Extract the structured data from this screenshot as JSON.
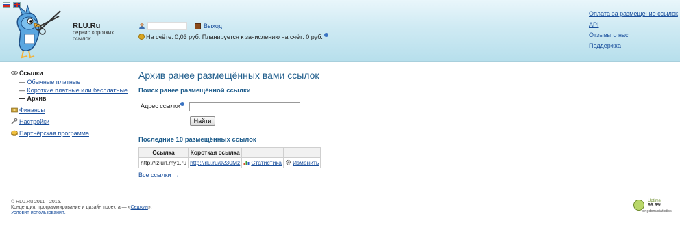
{
  "header": {
    "brand_name": "RLU.Ru",
    "brand_slogan": "сервис коротких ссылок",
    "exit_label": "Выход",
    "balance_text": "На счёте: 0,03 руб. Планируется к зачислению на счёт: 0 руб.",
    "top_links": [
      {
        "label": "Оплата за размещение ссылок"
      },
      {
        "label": "API"
      },
      {
        "label": "Отзывы о нас"
      },
      {
        "label": "Поддержка"
      }
    ]
  },
  "sidebar": {
    "links_title": "Ссылки",
    "sub_items": [
      {
        "label": "Обычные платные"
      },
      {
        "label": "Короткие платные или бесплатные"
      },
      {
        "label": "Архив"
      }
    ],
    "finance_label": "Финансы",
    "settings_label": "Настройки",
    "partner_label": "Партнёрская программа"
  },
  "main": {
    "title": "Архив ранее размещённых вами ссылок",
    "search_heading": "Поиск ранее размещённой ссылки",
    "address_label": "Адрес ссылки",
    "address_value": "",
    "find_button": "Найти",
    "recent_heading": "Последние 10 размещённых ссылок",
    "table": {
      "headers": [
        "Ссылка",
        "Короткая ссылка",
        "",
        ""
      ],
      "rows": [
        {
          "link": "http://izlurl.my1.ru",
          "short": "http://rlu.ru/0230Mz",
          "stats": "Статистика",
          "edit": "Изменить"
        }
      ]
    },
    "all_links": "Все ссылки →"
  },
  "footer": {
    "line1": "© RLU.Ru 2011—2015.",
    "line2_prefix": "Концепция, программирование и дизайн проекта — «",
    "line2_link": "Седжин",
    "line2_suffix": "».",
    "line3": "Условия использования."
  },
  "uptime": {
    "label": "Uptime",
    "value": "99.9%",
    "site": "pingdom/statistics"
  },
  "colors": {
    "header_gradient_top": "#e9f6fb",
    "header_gradient_bottom": "#b7dfec",
    "title": "#1f5d8c",
    "link": "#1a4f9c"
  }
}
